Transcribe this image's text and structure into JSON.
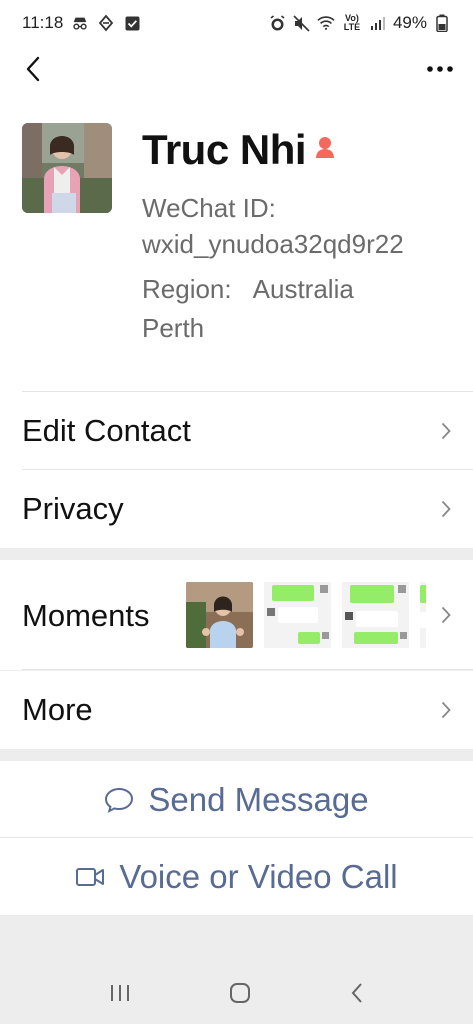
{
  "status_bar": {
    "time": "11:18",
    "battery": "49%",
    "network_label": "Vo) LTE"
  },
  "profile": {
    "name": "Truc Nhi",
    "wechat_id_label": "WeChat ID:",
    "wechat_id": "wxid_ynudoa32qd9r22",
    "region_label": "Region:",
    "region_country": "Australia",
    "region_city": "Perth"
  },
  "rows": {
    "edit_contact": "Edit Contact",
    "privacy": "Privacy",
    "moments": "Moments",
    "more": "More"
  },
  "actions": {
    "send_message": "Send Message",
    "call": "Voice or Video Call"
  },
  "colors": {
    "link": "#576b95",
    "gender_icon": "#f26a5d",
    "chat_bubble_green": "#95ec69"
  },
  "icons": [
    "back-icon",
    "more-icon",
    "female-gender-icon",
    "chevron-right-icon",
    "chat-bubble-icon",
    "video-camera-icon"
  ]
}
